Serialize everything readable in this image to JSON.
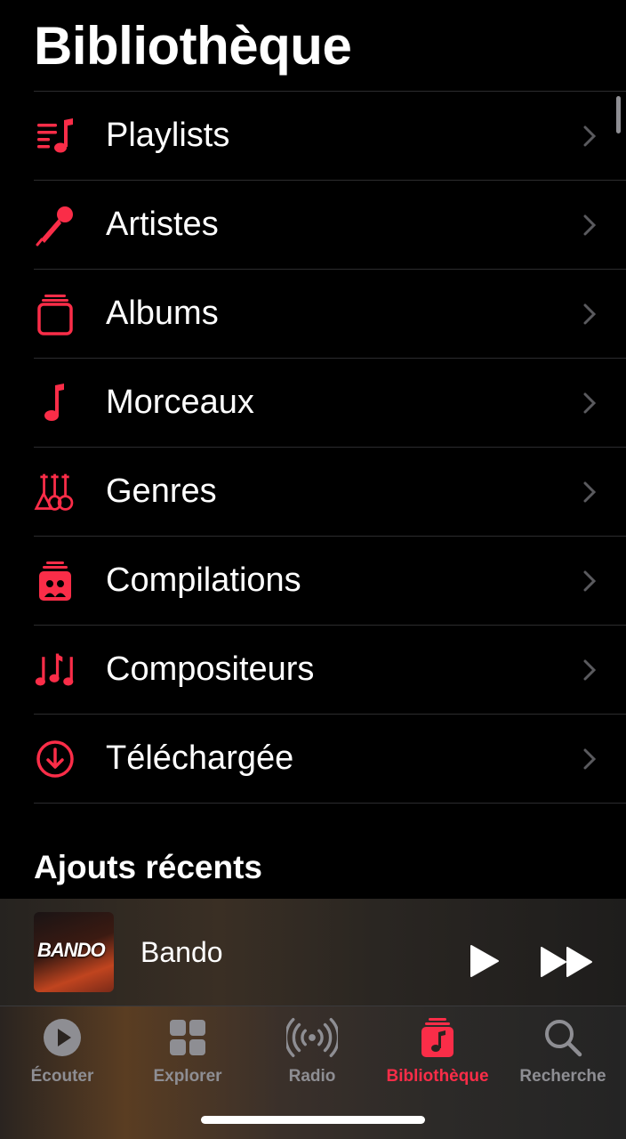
{
  "page_title": "Bibliothèque",
  "accent_color": "#fa2d48",
  "menu": [
    {
      "label": "Playlists",
      "icon": "playlist-icon"
    },
    {
      "label": "Artistes",
      "icon": "microphone-icon"
    },
    {
      "label": "Albums",
      "icon": "album-stack-icon"
    },
    {
      "label": "Morceaux",
      "icon": "music-note-icon"
    },
    {
      "label": "Genres",
      "icon": "guitars-icon"
    },
    {
      "label": "Compilations",
      "icon": "compilation-icon"
    },
    {
      "label": "Compositeurs",
      "icon": "composer-notes-icon"
    },
    {
      "label": "Téléchargée",
      "icon": "download-circle-icon"
    }
  ],
  "recent": {
    "heading": "Ajouts récents"
  },
  "now_playing": {
    "title": "Bando",
    "artwork_text": "BANDO"
  },
  "tabs": [
    {
      "label": "Écouter",
      "icon": "play-circle-icon",
      "active": false
    },
    {
      "label": "Explorer",
      "icon": "grid-icon",
      "active": false
    },
    {
      "label": "Radio",
      "icon": "radio-waves-icon",
      "active": false
    },
    {
      "label": "Bibliothèque",
      "icon": "library-icon",
      "active": true
    },
    {
      "label": "Recherche",
      "icon": "search-icon",
      "active": false
    }
  ]
}
